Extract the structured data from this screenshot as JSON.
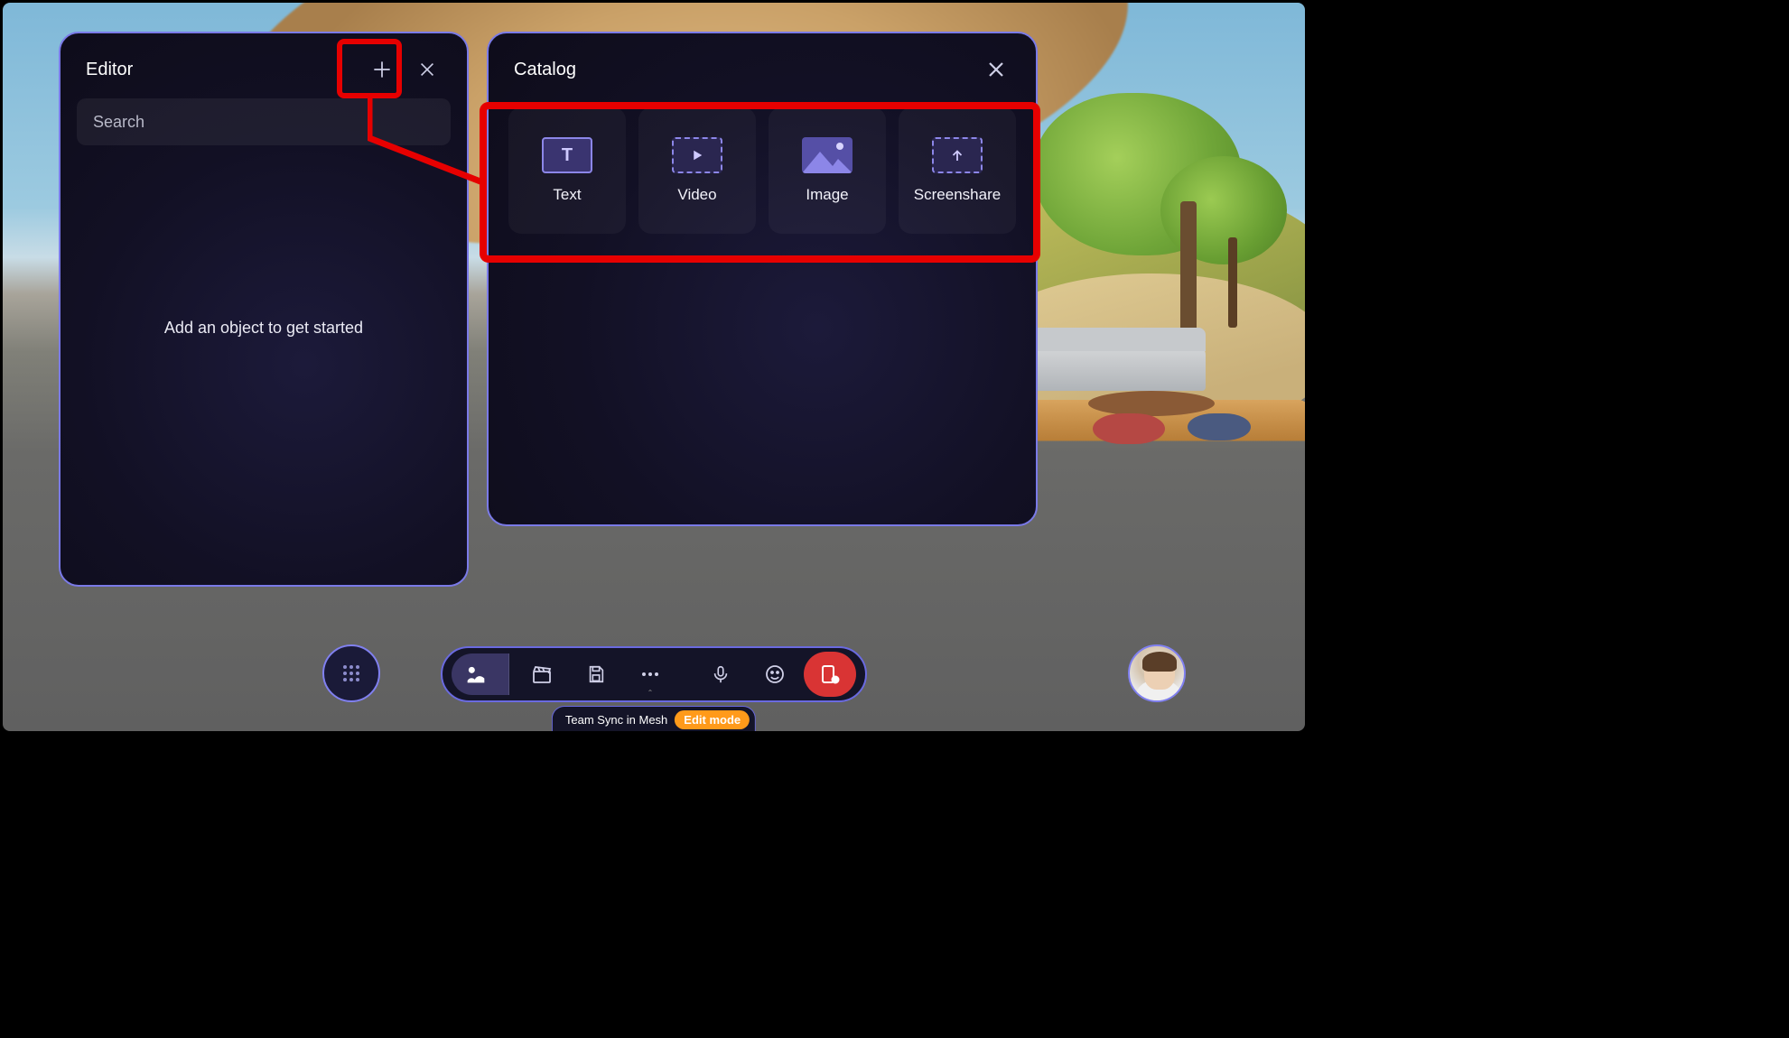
{
  "editor": {
    "title": "Editor",
    "search_placeholder": "Search",
    "empty_message": "Add an object to get started"
  },
  "catalog": {
    "title": "Catalog",
    "items": [
      {
        "label": "Text"
      },
      {
        "label": "Video"
      },
      {
        "label": "Image"
      },
      {
        "label": "Screenshare"
      }
    ]
  },
  "status": {
    "session": "Team Sync in Mesh",
    "mode": "Edit mode"
  },
  "colors": {
    "panel_border": "#7a7ae8",
    "highlight": "#e60000",
    "end_button": "#d93434",
    "mode_pill": "#ff9a1a"
  }
}
